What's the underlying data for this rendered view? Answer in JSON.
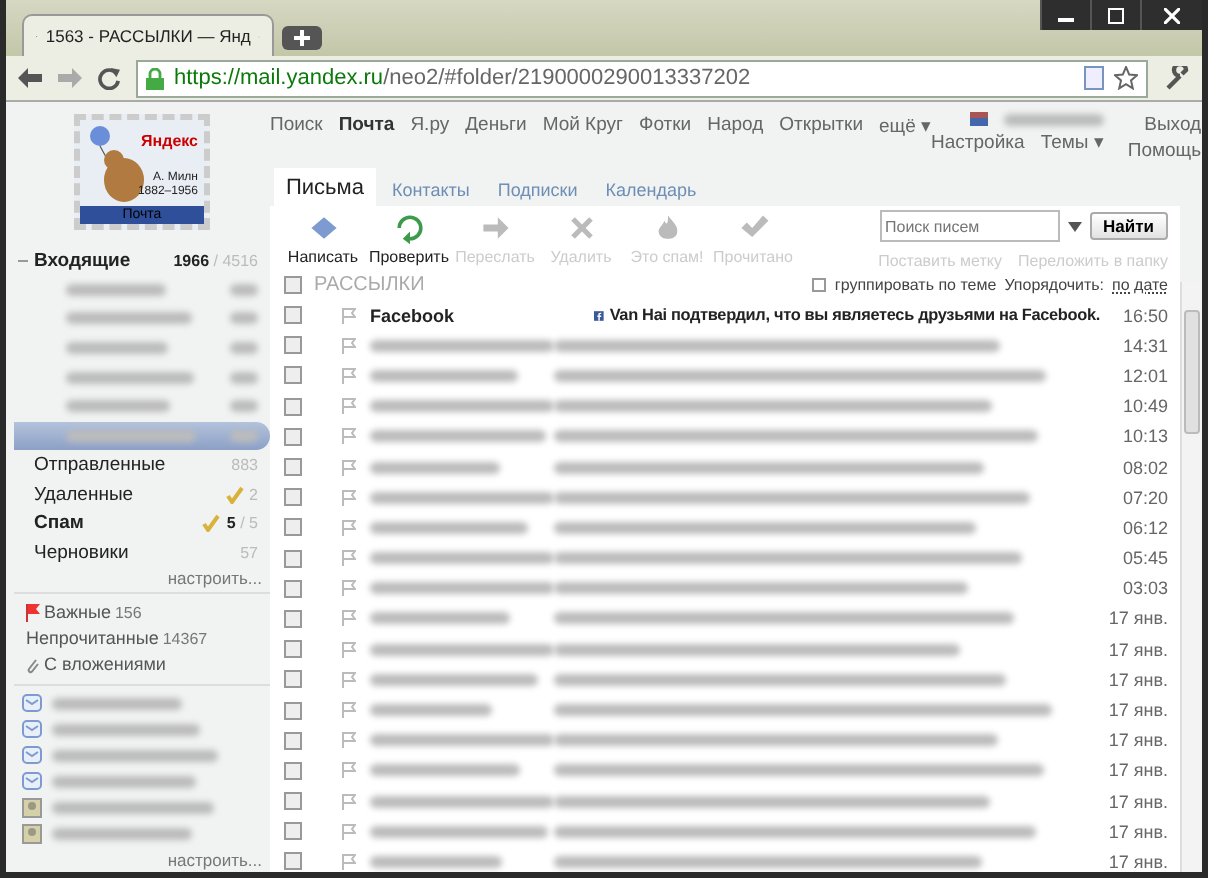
{
  "browser": {
    "tab_title": "1563 - РАССЫЛКИ — Янд",
    "url_host": "https://mail.yandex.ru",
    "url_path": "/neo2/#folder/2190000290013337202"
  },
  "logo": {
    "brand": "Яндекс",
    "caption": "А. Милн",
    "years": "1882–1956",
    "service": "Почта"
  },
  "services": [
    {
      "label": "Поиск",
      "selected": false
    },
    {
      "label": "Почта",
      "selected": true
    },
    {
      "label": "Я.ру",
      "selected": false
    },
    {
      "label": "Деньги",
      "selected": false
    },
    {
      "label": "Мой Круг",
      "selected": false
    },
    {
      "label": "Фотки",
      "selected": false
    },
    {
      "label": "Народ",
      "selected": false
    },
    {
      "label": "Открытки",
      "selected": false
    },
    {
      "label": "ещё ▾",
      "selected": false
    }
  ],
  "user_links": [
    "Настройка",
    "Темы ▾"
  ],
  "exit_links": [
    "Выход",
    "Помощь"
  ],
  "tabs": [
    {
      "label": "Письма",
      "selected": true
    },
    {
      "label": "Контакты",
      "selected": false
    },
    {
      "label": "Подписки",
      "selected": false
    },
    {
      "label": "Календарь",
      "selected": false
    }
  ],
  "actions": [
    {
      "label": "Написать",
      "kind": "compose",
      "disabled": false
    },
    {
      "label": "Проверить",
      "kind": "refresh",
      "disabled": false
    },
    {
      "label": "Переслать",
      "kind": "forward",
      "disabled": true
    },
    {
      "label": "Удалить",
      "kind": "delete",
      "disabled": true
    },
    {
      "label": "Это спам!",
      "kind": "spam",
      "disabled": true
    },
    {
      "label": "Прочитано",
      "kind": "read",
      "disabled": true
    }
  ],
  "search": {
    "placeholder": "Поиск писем",
    "button": "Найти"
  },
  "sub_actions": [
    {
      "label": "Поставить метку",
      "disabled": true
    },
    {
      "label": "Переложить в папку",
      "disabled": true
    }
  ],
  "list_header": {
    "all_checked": false,
    "folder": "РАССЫЛКИ",
    "group_label": "группировать по теме",
    "group_checked": false,
    "sort_label": "Упорядочить:",
    "sort_value": "по дате"
  },
  "folders": [
    {
      "name": "Входящие",
      "unread": true,
      "counts": "**1966** / 4516",
      "expanded": true,
      "selected": false,
      "cleanable": false,
      "children": [
        {
          "selected": false
        },
        {
          "selected": false
        },
        {
          "selected": false
        },
        {
          "selected": false
        },
        {
          "selected": false
        },
        {
          "selected": true
        }
      ]
    },
    {
      "name": "Отправленные",
      "unread": false,
      "counts": "883",
      "selected": false,
      "cleanable": false
    },
    {
      "name": "Удаленные",
      "unread": false,
      "counts": "2",
      "selected": false,
      "cleanable": true
    },
    {
      "name": "Спам",
      "unread": true,
      "counts": "**5** / 5",
      "selected": false,
      "cleanable": true
    },
    {
      "name": "Черновики",
      "unread": false,
      "counts": "57",
      "selected": false,
      "cleanable": false
    }
  ],
  "folders_setup": "настроить...",
  "filters": [
    {
      "label": "Важные",
      "count": "156",
      "kind": "flag"
    },
    {
      "label": "Непрочитанные",
      "count": "14367",
      "kind": "plain"
    },
    {
      "label": "С вложениями",
      "kind": "clip"
    }
  ],
  "contacts": [
    {
      "kind": "mail"
    },
    {
      "kind": "mail"
    },
    {
      "kind": "mail"
    },
    {
      "kind": "mail"
    },
    {
      "kind": "avatar"
    },
    {
      "kind": "avatar"
    }
  ],
  "contacts_setup": "настроить...",
  "messages": [
    {
      "sender": "Facebook",
      "subject": "Van Hai подтвердил, что вы являетесь друзьями на Facebook.",
      "time": "16:50",
      "unread": true,
      "checked": false
    },
    {
      "time": "14:31",
      "unread": false,
      "checked": false
    },
    {
      "time": "12:01",
      "unread": false,
      "checked": false
    },
    {
      "time": "10:49",
      "unread": false,
      "checked": false
    },
    {
      "time": "10:13",
      "unread": false,
      "checked": false
    },
    {
      "time": "08:02",
      "unread": false,
      "checked": false
    },
    {
      "time": "07:20",
      "unread": false,
      "checked": false
    },
    {
      "time": "06:12",
      "unread": false,
      "checked": false
    },
    {
      "time": "05:45",
      "unread": false,
      "checked": false
    },
    {
      "time": "03:03",
      "unread": false,
      "checked": false
    },
    {
      "time": "17 янв.",
      "unread": false,
      "checked": false
    },
    {
      "time": "17 янв.",
      "unread": false,
      "checked": false
    },
    {
      "time": "17 янв.",
      "unread": false,
      "checked": false
    },
    {
      "time": "17 янв.",
      "unread": false,
      "checked": false
    },
    {
      "time": "17 янв.",
      "unread": false,
      "checked": false
    },
    {
      "time": "17 янв.",
      "unread": false,
      "checked": false
    },
    {
      "time": "17 янв.",
      "unread": false,
      "checked": false
    },
    {
      "time": "17 янв.",
      "unread": false,
      "checked": false
    },
    {
      "time": "17 янв.",
      "unread": false,
      "checked": false
    }
  ]
}
